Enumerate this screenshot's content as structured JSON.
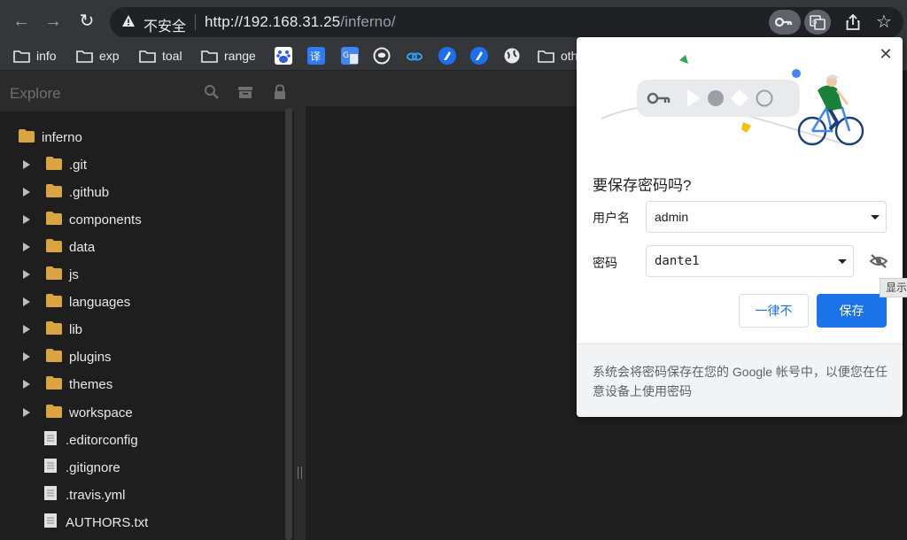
{
  "browser": {
    "insecure_label": "不安全",
    "url_host": "http://192.168.31.25",
    "url_path": "/inferno/"
  },
  "bookmarks": [
    {
      "label": "info"
    },
    {
      "label": "exp"
    },
    {
      "label": "toal"
    },
    {
      "label": "range"
    },
    {
      "label": "oth"
    }
  ],
  "bookmark_icons": [
    "baidu-icon",
    "translate-icon",
    "google-translate-icon",
    "github-icon",
    "cloud-icon",
    "app-icon",
    "app-icon",
    "globe-icon"
  ],
  "sidebar": {
    "title": "Explore",
    "root": "inferno",
    "folders": [
      ".git",
      ".github",
      "components",
      "data",
      "js",
      "languages",
      "lib",
      "plugins",
      "themes",
      "workspace"
    ],
    "files": [
      ".editorconfig",
      ".gitignore",
      ".travis.yml",
      "AUTHORS.txt"
    ]
  },
  "password_bubble": {
    "title": "要保存密码吗?",
    "username_label": "用户名",
    "username_value": "admin",
    "password_label": "密码",
    "password_value": "dante1",
    "never_button": "一律不",
    "save_button": "保存",
    "footer": "系统会将密码保存在您的 Google 帐号中，以便您在任意设备上使用密码"
  },
  "tooltip": "显示",
  "colors": {
    "accent": "#1a73e8",
    "folder": "#d9a441",
    "chrome_bg": "#35363a",
    "editor_bg": "#1e1e1e"
  }
}
